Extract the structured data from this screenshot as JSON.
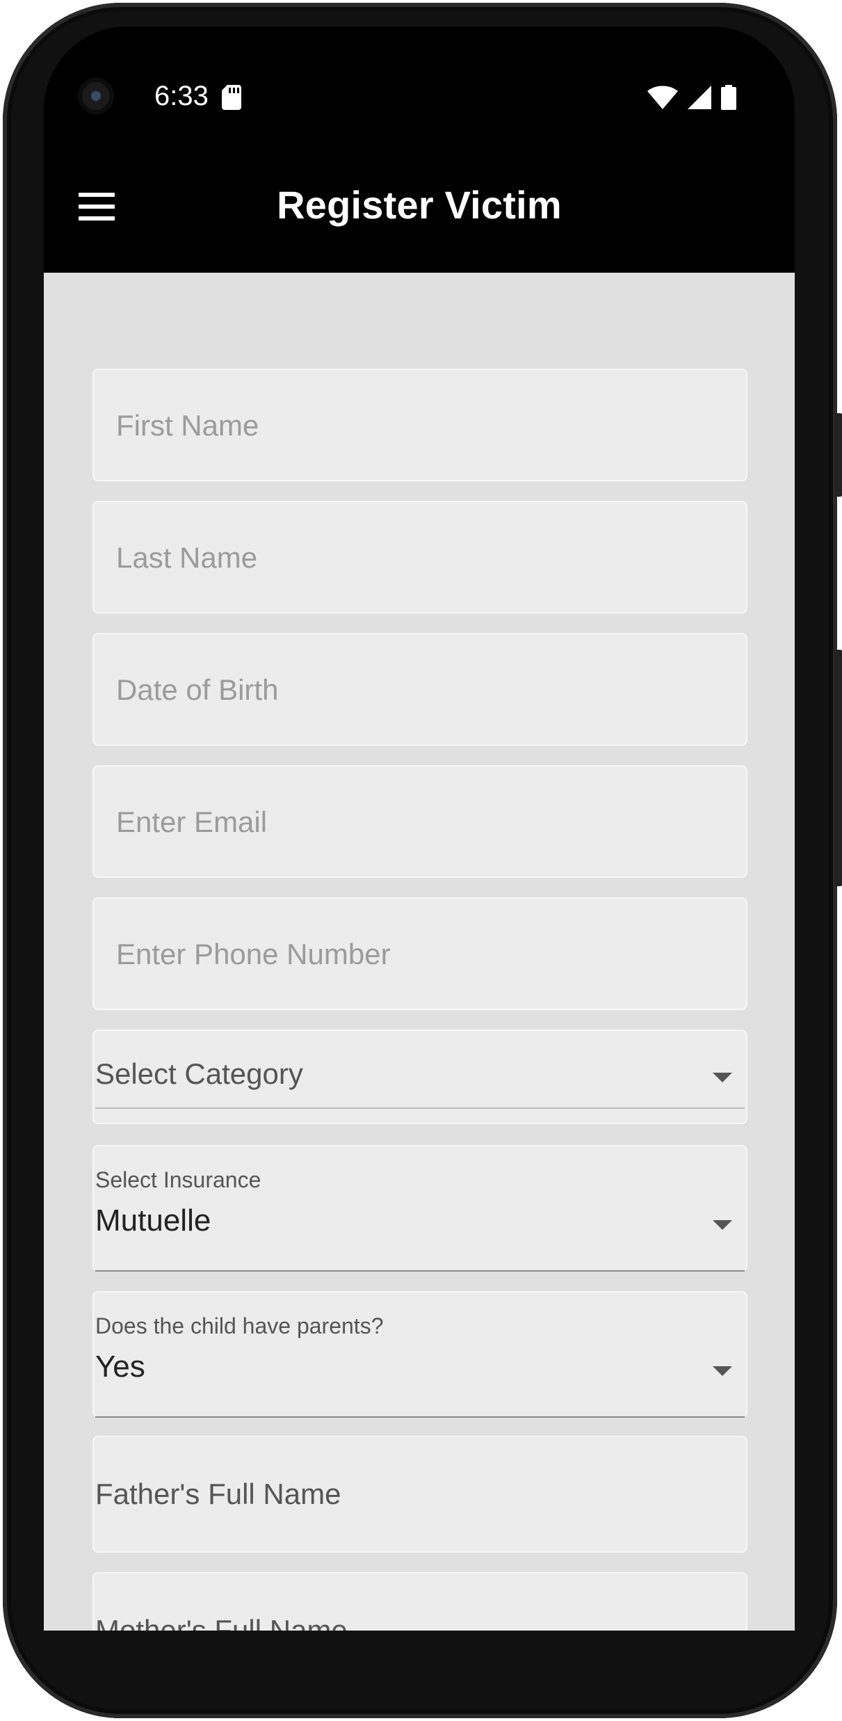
{
  "status_bar": {
    "time": "6:33",
    "icons": [
      "sd-card-icon",
      "wifi-icon",
      "cell-signal-icon",
      "battery-icon"
    ]
  },
  "app_bar": {
    "title": "Register Victim",
    "menu_icon": "menu-icon"
  },
  "form": {
    "first_name": {
      "placeholder": "First Name",
      "value": ""
    },
    "last_name": {
      "placeholder": "Last Name",
      "value": ""
    },
    "date_of_birth": {
      "placeholder": "Date of Birth",
      "value": ""
    },
    "email": {
      "placeholder": "Enter Email",
      "value": ""
    },
    "phone": {
      "placeholder": "Enter Phone Number",
      "value": ""
    },
    "category": {
      "hint": "Select Category",
      "value": ""
    },
    "insurance": {
      "label": "Select Insurance",
      "value": "Mutuelle"
    },
    "has_parents": {
      "label": "Does the child have parents?",
      "value": "Yes"
    },
    "father_name": {
      "hint": "Father's Full Name"
    },
    "mother_name": {
      "hint": "Mother's Full Name"
    }
  },
  "colors": {
    "app_bar": "#000000",
    "background": "#e0e0e0",
    "field_fill": "#ececec",
    "hint_text": "#9b9b9b"
  }
}
